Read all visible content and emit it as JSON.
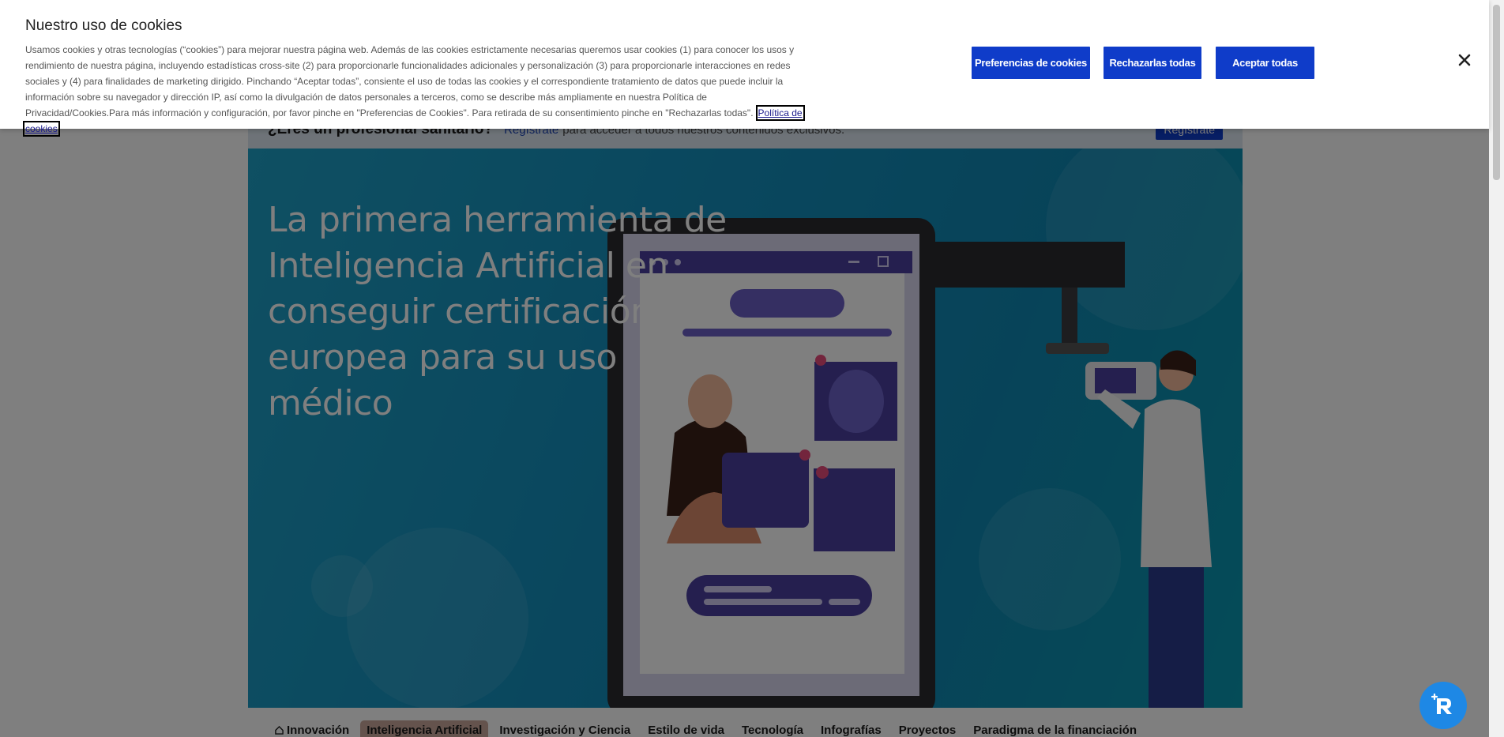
{
  "cookie_banner": {
    "title": "Nuestro uso de cookies",
    "text": "Usamos cookies y otras tecnologías (“cookies”) para mejorar nuestra página web. Además de las cookies estrictamente necesarias queremos usar cookies (1) para conocer los usos y rendimiento de nuestra página, incluyendo estadísticas cross-site (2) para proporcionarle funcionalidades adicionales y personalización (3) para proporcionarle interacciones en redes sociales y (4) para finalidades de marketing dirigido. Pinchando “Aceptar todas”, consiente el uso de todas las cookies y el correspondiente tratamiento de datos que puede incluir la información sobre su navegador y dirección IP, así como la divulgación de datos personales a terceros, como se describe más ampliamente en nuestra Política de Privacidad/Cookies.Para más información y configuración, por favor pinche en \"Preferencias de Cookies\". Para retirada de su consentimiento pinche en \"Rechazarlas todas\".",
    "policy_link": "Política de cookies",
    "preferences_button": "Preferencias de cookies",
    "reject_button": "Rechazarlas todas",
    "accept_button": "Aceptar todas",
    "close_icon": "close-icon"
  },
  "topbar": {
    "question": "¿Eres un profesional sanitario?",
    "link": "Regístrate",
    "rest": "para acceder a todos nuestros contenidos exclusivos.",
    "button": "Regístrate"
  },
  "hero": {
    "title": "La primera herramienta de Inteligencia Artificial en conseguir certificación europea para su uso médico"
  },
  "categories": [
    {
      "label": "Innovación",
      "icon": "home-icon",
      "active": false
    },
    {
      "label": "Inteligencia Artificial",
      "active": true
    },
    {
      "label": "Investigación y Ciencia",
      "active": false
    },
    {
      "label": "Estilo de vida",
      "active": false
    },
    {
      "label": "Tecnología",
      "active": false
    },
    {
      "label": "Infografías",
      "active": false
    },
    {
      "label": "Proyectos",
      "active": false
    },
    {
      "label": "Paradigma de la financiación",
      "active": false
    }
  ],
  "colors": {
    "brand_blue": "#0f3cc9",
    "hero_teal": "#148fbd",
    "fab_blue": "#1e88e5"
  },
  "chat": {
    "icon": "chat-assistant-icon"
  }
}
